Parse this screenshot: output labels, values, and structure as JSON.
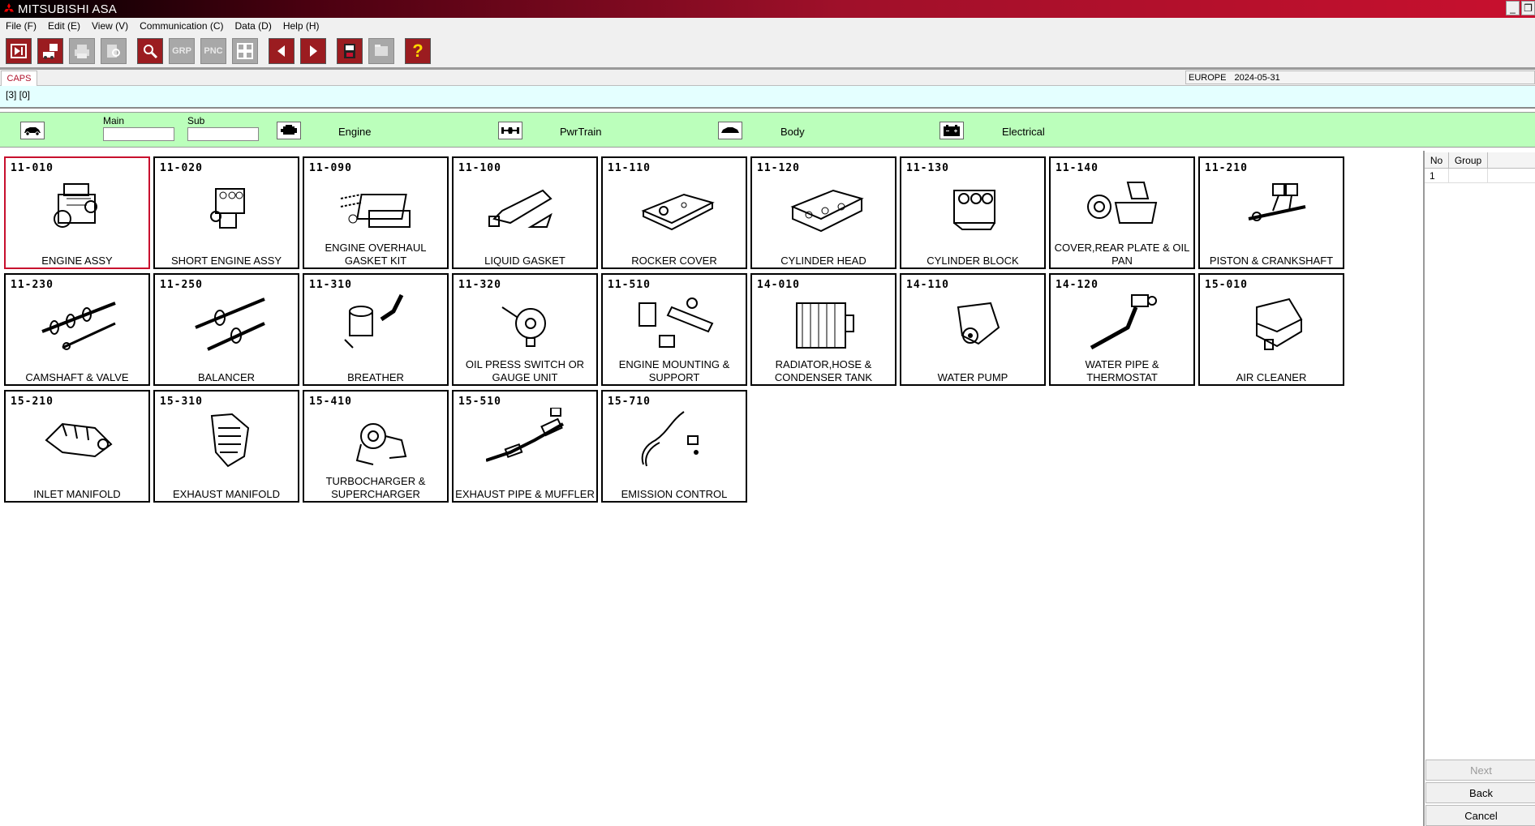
{
  "window": {
    "title": "MITSUBISHI ASA",
    "min_label": "_",
    "restore_label": "❐"
  },
  "menu": [
    "File (F)",
    "Edit (E)",
    "View (V)",
    "Communication (C)",
    "Data (D)",
    "Help (H)"
  ],
  "toolbar": {
    "grp_label": "GRP",
    "pnc_label": "PNC",
    "help_label": "?"
  },
  "tabs": {
    "caps": "CAPS"
  },
  "region": {
    "name": "EUROPE",
    "date": "2024-05-31"
  },
  "status": {
    "text": "[3] [0]"
  },
  "category": {
    "main_label": "Main",
    "sub_label": "Sub",
    "main_value": "",
    "sub_value": "",
    "engine": "Engine",
    "pwrtrain": "PwrTrain",
    "body": "Body",
    "electrical": "Electrical"
  },
  "tiles": [
    {
      "code": "11-010",
      "name": "ENGINE ASSY"
    },
    {
      "code": "11-020",
      "name": "SHORT ENGINE ASSY"
    },
    {
      "code": "11-090",
      "name": "ENGINE OVERHAUL GASKET KIT"
    },
    {
      "code": "11-100",
      "name": "LIQUID GASKET"
    },
    {
      "code": "11-110",
      "name": "ROCKER COVER"
    },
    {
      "code": "11-120",
      "name": "CYLINDER HEAD"
    },
    {
      "code": "11-130",
      "name": "CYLINDER BLOCK"
    },
    {
      "code": "11-140",
      "name": "COVER,REAR PLATE & OIL PAN"
    },
    {
      "code": "11-210",
      "name": "PISTON & CRANKSHAFT"
    },
    {
      "code": "11-230",
      "name": "CAMSHAFT & VALVE"
    },
    {
      "code": "11-250",
      "name": "BALANCER"
    },
    {
      "code": "11-310",
      "name": "BREATHER"
    },
    {
      "code": "11-320",
      "name": "OIL PRESS SWITCH OR GAUGE UNIT"
    },
    {
      "code": "11-510",
      "name": "ENGINE MOUNTING & SUPPORT"
    },
    {
      "code": "14-010",
      "name": "RADIATOR,HOSE & CONDENSER TANK"
    },
    {
      "code": "14-110",
      "name": "WATER PUMP"
    },
    {
      "code": "14-120",
      "name": "WATER PIPE & THERMOSTAT"
    },
    {
      "code": "15-010",
      "name": "AIR CLEANER"
    },
    {
      "code": "15-210",
      "name": "INLET MANIFOLD"
    },
    {
      "code": "15-310",
      "name": "EXHAUST MANIFOLD"
    },
    {
      "code": "15-410",
      "name": "TURBOCHARGER & SUPERCHARGER"
    },
    {
      "code": "15-510",
      "name": "EXHAUST PIPE & MUFFLER"
    },
    {
      "code": "15-710",
      "name": "EMISSION CONTROL"
    }
  ],
  "group_table": {
    "headers": [
      "No",
      "Group"
    ],
    "rows": [
      {
        "no": "1",
        "group": ""
      }
    ]
  },
  "buttons": {
    "next": "Next",
    "back": "Back",
    "cancel": "Cancel"
  }
}
